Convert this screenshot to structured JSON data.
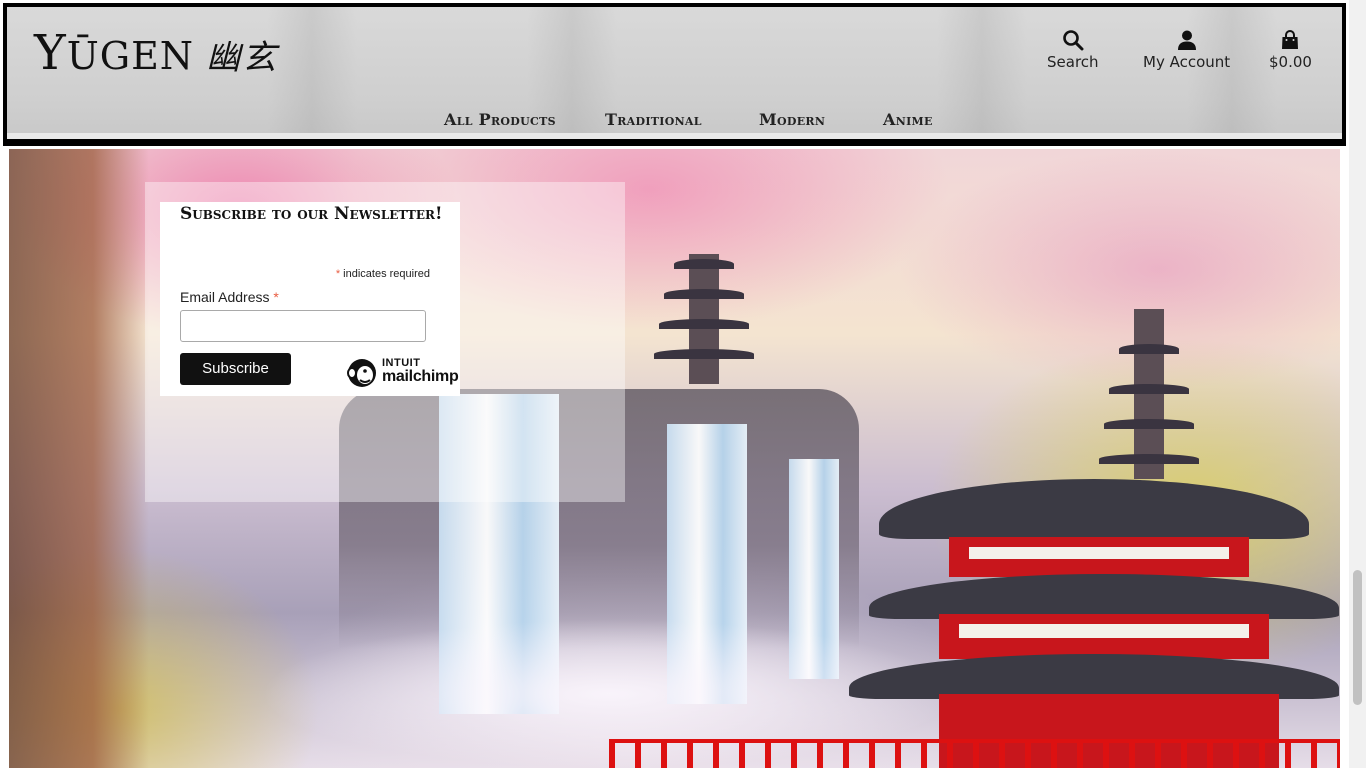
{
  "header": {
    "logo_word_first": "Y",
    "logo_word_rest": "ŪGEN",
    "logo_kanji": "幽玄",
    "search_label": "Search",
    "account_label": "My Account",
    "cart_total": "$0.00",
    "nav": {
      "all_products": "All Products",
      "traditional": "Traditional",
      "modern": "Modern",
      "anime": "Anime"
    }
  },
  "newsletter": {
    "title": "Subscribe to our Newsletter!",
    "required_asterisk": "*",
    "required_note": " indicates required",
    "email_label": "Email Address",
    "email_value": "",
    "subscribe_label": "Subscribe",
    "badge_top": "INTUIT",
    "badge_bottom": "mailchimp"
  },
  "colors": {
    "header_bg": "#d2d2d2",
    "button_bg": "#111111",
    "asterisk": "#e85c41",
    "temple_red": "#c8161c"
  },
  "icons": [
    "search-icon",
    "user-icon",
    "shopping-bag-icon",
    "mailchimp-logo-icon"
  ],
  "scroll": {
    "position_fraction": 0.8
  }
}
